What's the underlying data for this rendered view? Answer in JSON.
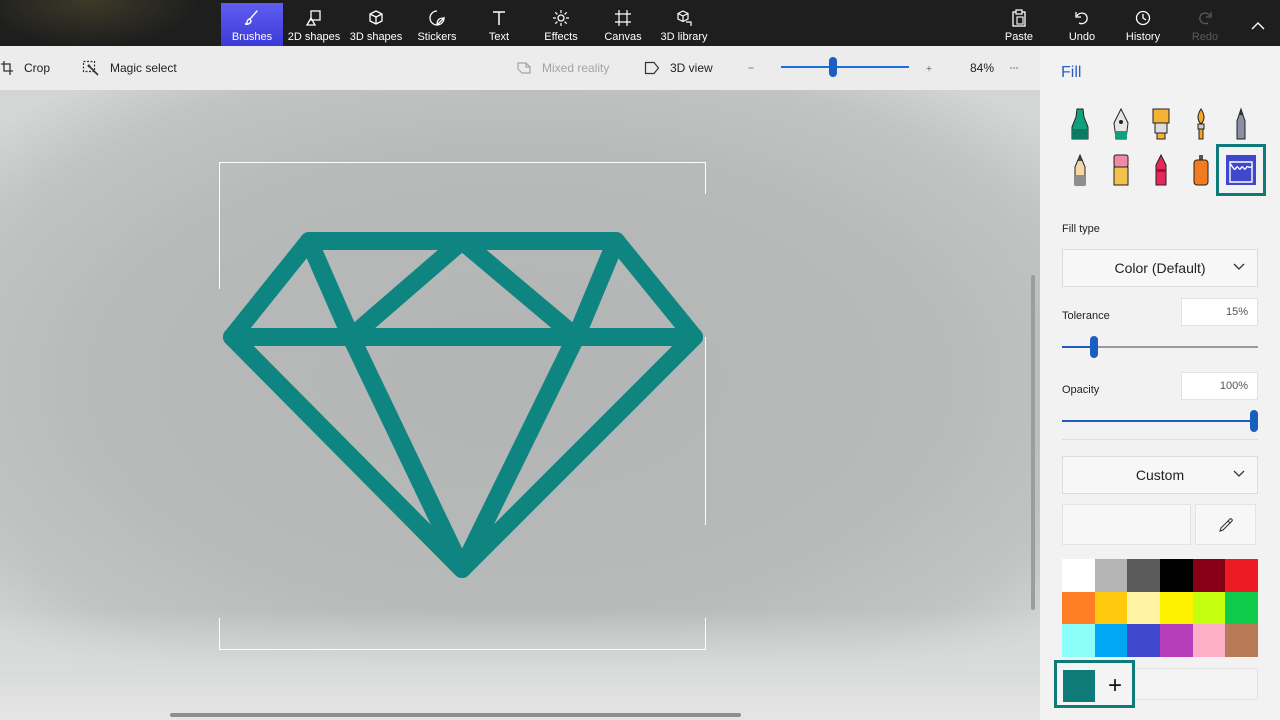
{
  "ribbon": {
    "tools": [
      {
        "label": "Brushes",
        "icon": "brushes-icon"
      },
      {
        "label": "2D shapes",
        "icon": "2d-shapes-icon"
      },
      {
        "label": "3D shapes",
        "icon": "3d-shapes-icon"
      },
      {
        "label": "Stickers",
        "icon": "stickers-icon"
      },
      {
        "label": "Text",
        "icon": "text-icon"
      },
      {
        "label": "Effects",
        "icon": "effects-icon"
      },
      {
        "label": "Canvas",
        "icon": "canvas-icon"
      },
      {
        "label": "3D library",
        "icon": "3d-library-icon"
      }
    ],
    "active_tool": "Brushes",
    "actions": [
      {
        "label": "Paste",
        "icon": "paste-icon"
      },
      {
        "label": "Undo",
        "icon": "undo-icon"
      },
      {
        "label": "History",
        "icon": "history-icon"
      },
      {
        "label": "Redo",
        "icon": "redo-icon",
        "disabled": true
      }
    ],
    "collapse_icon": "chevron-up-icon"
  },
  "toolbar": {
    "crop_label": "Crop",
    "magic_select_label": "Magic select",
    "mixed_reality_label": "Mixed reality",
    "view_3d_label": "3D view",
    "zoom_percent": "84%",
    "zoom_level": 0.41,
    "more_icon": "ellipsis-icon"
  },
  "canvas": {
    "drawing": "diamond-outline",
    "stroke_color": "#0f8581"
  },
  "panel": {
    "title": "Fill",
    "brushes": [
      "marker",
      "calligraphy-pen",
      "oil-brush",
      "watercolor",
      "pencil-gray",
      "pencil",
      "eraser",
      "crayon",
      "spray-can",
      "fill"
    ],
    "selected_brush": "fill",
    "fill_type_label": "Fill type",
    "fill_type_value": "Color (Default)",
    "tolerance_label": "Tolerance",
    "tolerance_value": "15%",
    "tolerance_level": 0.15,
    "opacity_label": "Opacity",
    "opacity_value": "100%",
    "opacity_level": 1.0,
    "color_mode_value": "Custom",
    "palette": [
      "#ffffff",
      "#b4b4b4",
      "#5a5a5a",
      "#000000",
      "#880015",
      "#ed1c24",
      "#ff7f27",
      "#ffc90e",
      "#fff2a0",
      "#fff200",
      "#c4ff0e",
      "#0ecb4a",
      "#8cfffb",
      "#00a8f3",
      "#3f48cc",
      "#b83dba",
      "#ffaec8",
      "#b97a57"
    ],
    "custom_color": "#0f7b78",
    "add_color_label": "+"
  },
  "accent_colors": {
    "active_tool": "#4b48e0",
    "selection": "#0f7b78",
    "slider": "#1a5fc0",
    "title": "#2b5fbf"
  }
}
